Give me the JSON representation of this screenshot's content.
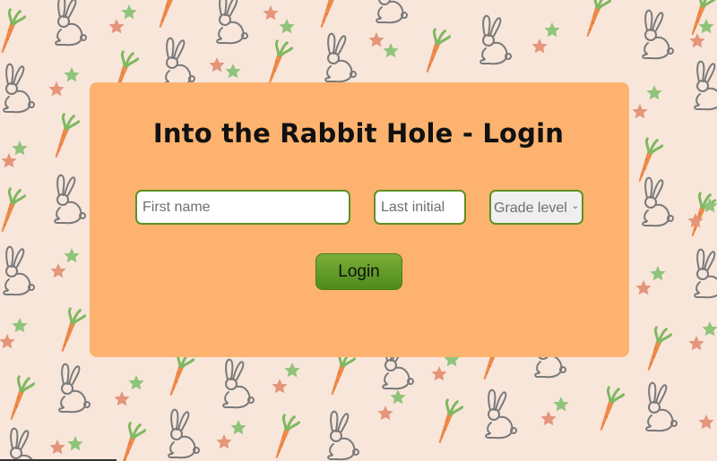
{
  "page": {
    "title": "Into the Rabbit Hole - Login"
  },
  "form": {
    "first_name": {
      "value": "",
      "placeholder": "First name"
    },
    "last_initial": {
      "value": "",
      "placeholder": "Last initial"
    },
    "grade_level": {
      "selected": "Grade level"
    },
    "login_label": "Login"
  },
  "background": {
    "pattern_icons": [
      "rabbit-icon",
      "carrot-icon",
      "star-icon"
    ]
  },
  "colors": {
    "page_bg": "#f8e6db",
    "card": "#fdb36f",
    "accent_green": "#5d9124",
    "rabbit": "#7a7a7a",
    "carrot": "#ef8a4a",
    "star_orange": "#e4957a",
    "star_green": "#8fc47a"
  }
}
